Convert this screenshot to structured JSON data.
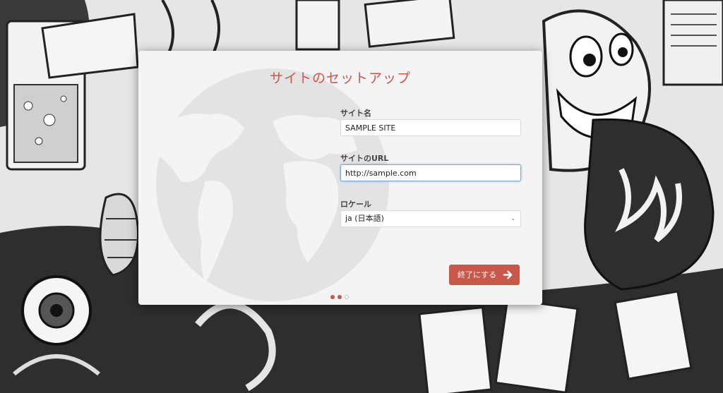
{
  "dialog": {
    "title": "サイトのセットアップ",
    "site_name": {
      "label": "サイト名",
      "value": "SAMPLE SITE"
    },
    "site_url": {
      "label": "サイトのURL",
      "value": "http://sample.com"
    },
    "locale": {
      "label": "ロケール",
      "selected": "ja (日本語)",
      "chevron": "⌄"
    },
    "finish_button": {
      "label": "終了にする",
      "icon": "arrow-right-icon"
    },
    "steps": {
      "total": 3,
      "current": 2
    }
  },
  "colors": {
    "accent": "#c9574a",
    "dialog_bg": "#f4f4f4",
    "focus_border": "#7fa7d8"
  }
}
